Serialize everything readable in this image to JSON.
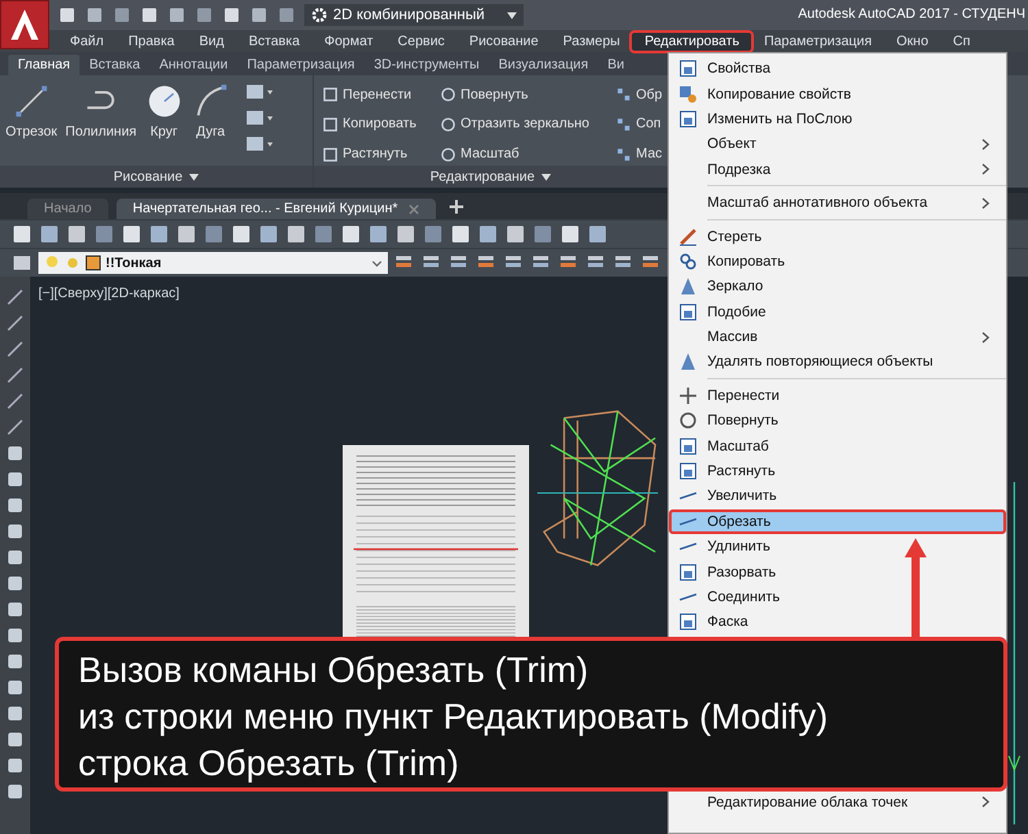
{
  "title_bar": {
    "workspace": "2D комбинированный",
    "title": "Autodesk AutoCAD 2017 - СТУДЕНЧ"
  },
  "menu_bar": [
    {
      "label": "Файл",
      "selected": false
    },
    {
      "label": "Правка",
      "selected": false
    },
    {
      "label": "Вид",
      "selected": false
    },
    {
      "label": "Вставка",
      "selected": false
    },
    {
      "label": "Формат",
      "selected": false
    },
    {
      "label": "Сервис",
      "selected": false
    },
    {
      "label": "Рисование",
      "selected": false
    },
    {
      "label": "Размеры",
      "selected": false
    },
    {
      "label": "Редактировать",
      "selected": true
    },
    {
      "label": "Параметризация",
      "selected": false
    },
    {
      "label": "Окно",
      "selected": false
    },
    {
      "label": "Сп",
      "selected": false
    }
  ],
  "ribbon_tabs": [
    {
      "label": "Главная",
      "selected": true
    },
    {
      "label": "Вставка",
      "selected": false
    },
    {
      "label": "Аннотации",
      "selected": false
    },
    {
      "label": "Параметризация",
      "selected": false
    },
    {
      "label": "3D-инструменты",
      "selected": false
    },
    {
      "label": "Визуализация",
      "selected": false
    },
    {
      "label": "Ви",
      "selected": false
    }
  ],
  "ribbon": {
    "draw_panel": {
      "title": "Рисование",
      "tools": [
        "Отрезок",
        "Полилиния",
        "Круг",
        "Дуга"
      ]
    },
    "modify_panel": {
      "title": "Редактирование",
      "rows": [
        [
          "Перенести",
          "Повернуть",
          "Обр"
        ],
        [
          "Копировать",
          "Отразить зеркально",
          "Соп"
        ],
        [
          "Растянуть",
          "Масштаб",
          "Мас"
        ]
      ]
    }
  },
  "file_tabs": [
    {
      "label": "Начало",
      "selected": false
    },
    {
      "label": "Начертательная гео... - Евгений Курицин*",
      "selected": true
    }
  ],
  "layer": {
    "name": "!!Тонкая"
  },
  "viewport_label": "[−][Сверху][2D-каркас]",
  "menu": {
    "items": [
      {
        "kind": "item",
        "label": "Свойства",
        "submenu": false,
        "selected": false
      },
      {
        "kind": "item",
        "label": "Копирование свойств",
        "submenu": false,
        "selected": false
      },
      {
        "kind": "item",
        "label": "Изменить на ПоСлою",
        "submenu": false,
        "selected": false
      },
      {
        "kind": "item",
        "label": "Объект",
        "submenu": true,
        "selected": false
      },
      {
        "kind": "item",
        "label": "Подрезка",
        "submenu": true,
        "selected": false
      },
      {
        "kind": "separator"
      },
      {
        "kind": "item",
        "label": "Масштаб аннотативного объекта",
        "submenu": true,
        "selected": false
      },
      {
        "kind": "separator"
      },
      {
        "kind": "item",
        "label": "Стереть",
        "submenu": false,
        "selected": false
      },
      {
        "kind": "item",
        "label": "Копировать",
        "submenu": false,
        "selected": false
      },
      {
        "kind": "item",
        "label": "Зеркало",
        "submenu": false,
        "selected": false
      },
      {
        "kind": "item",
        "label": "Подобие",
        "submenu": false,
        "selected": false
      },
      {
        "kind": "item",
        "label": "Массив",
        "submenu": true,
        "selected": false
      },
      {
        "kind": "item",
        "label": "Удалять повторяющиеся объекты",
        "submenu": false,
        "selected": false
      },
      {
        "kind": "separator"
      },
      {
        "kind": "item",
        "label": "Перенести",
        "submenu": false,
        "selected": false
      },
      {
        "kind": "item",
        "label": "Повернуть",
        "submenu": false,
        "selected": false
      },
      {
        "kind": "item",
        "label": "Масштаб",
        "submenu": false,
        "selected": false
      },
      {
        "kind": "item",
        "label": "Растянуть",
        "submenu": false,
        "selected": false
      },
      {
        "kind": "item",
        "label": "Увеличить",
        "submenu": false,
        "selected": false
      },
      {
        "kind": "item",
        "label": "Обрезать",
        "submenu": false,
        "selected": true
      },
      {
        "kind": "item",
        "label": "Удлинить",
        "submenu": false,
        "selected": false
      },
      {
        "kind": "item",
        "label": "Разорвать",
        "submenu": false,
        "selected": false
      },
      {
        "kind": "item",
        "label": "Соединить",
        "submenu": false,
        "selected": false
      },
      {
        "kind": "item",
        "label": "Фаска",
        "submenu": false,
        "selected": false
      }
    ],
    "bottom_items": [
      {
        "kind": "item",
        "label": "Редактирование облака точек",
        "submenu": true,
        "selected": false
      }
    ]
  },
  "caption": {
    "lines": [
      "Вызов команы Обрезать (Trim)",
      "из строки меню пункт Редактировать (Modify)",
      "строка Обрезать (Trim)"
    ]
  }
}
